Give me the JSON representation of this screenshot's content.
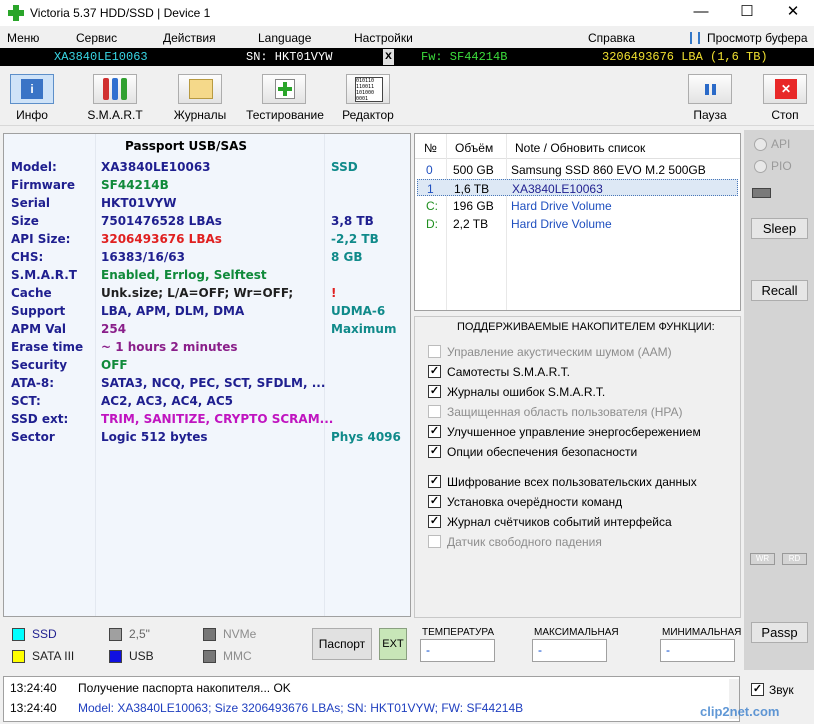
{
  "window": {
    "title": "Victoria 5.37 HDD/SSD | Device 1",
    "minimize": "—",
    "maximize": "☐",
    "close": "✕"
  },
  "menu": [
    "Меню",
    "Сервис",
    "Действия",
    "Language",
    "Настройки",
    "Справка",
    "Просмотр буфера"
  ],
  "infobar": {
    "model": "XA3840LE10063",
    "sn": "SN: HKT01VYW",
    "x": "x",
    "fw": "Fw: SF44214B",
    "lba": "3206493676 LBA (1,6 TB)",
    "colors": {
      "model": "#39d7e6",
      "sn": "#ffffff",
      "fw": "#3cdc3c",
      "lba": "#f0e030"
    }
  },
  "toolbar": {
    "info": "Инфо",
    "smart": "S.M.A.R.T",
    "logs": "Журналы",
    "test": "Тестирование",
    "editor": "Редактор",
    "pause": "Пауза",
    "stop": "Стоп",
    "editor_icon_text": "010110\n110011\n101000\n0001"
  },
  "passport": {
    "title": "Passport USB/SAS",
    "rows": [
      {
        "label": "Model:",
        "value": "XA3840LE10063",
        "extra": "SSD",
        "vcolor": "#1f1f8f",
        "ecolor": "#108a8a"
      },
      {
        "label": "Firmware",
        "value": "SF44214B",
        "extra": "",
        "vcolor": "#108a3a",
        "ecolor": ""
      },
      {
        "label": "Serial",
        "value": "HKT01VYW",
        "extra": "",
        "vcolor": "#1f1f8f",
        "ecolor": ""
      },
      {
        "label": "Size",
        "value": "7501476528 LBAs",
        "extra": "3,8 TB",
        "vcolor": "#1f1f8f",
        "ecolor": "#1f1f8f"
      },
      {
        "label": "API Size:",
        "value": "3206493676 LBAs",
        "extra": "-2,2 TB",
        "vcolor": "#e02020",
        "ecolor": "#108a8a"
      },
      {
        "label": "CHS:",
        "value": "16383/16/63",
        "extra": "8 GB",
        "vcolor": "#1f1f8f",
        "ecolor": "#108a8a"
      },
      {
        "label": "S.M.A.R.T",
        "value": "Enabled, Errlog, Selftest",
        "extra": "",
        "vcolor": "#108a3a",
        "ecolor": ""
      },
      {
        "label": "Cache",
        "value": "Unk.size; L/A=OFF; Wr=OFF;",
        "extra": "!",
        "vcolor": "#1f1f1f",
        "ecolor": "#e02020"
      },
      {
        "label": "Support",
        "value": "LBA, APM, DLM, DMA",
        "extra": "UDMA-6",
        "vcolor": "#1f1f8f",
        "ecolor": "#108a8a"
      },
      {
        "label": "APM Val",
        "value": "254",
        "extra": "Maximum",
        "vcolor": "#8a1f8a",
        "ecolor": "#108a8a"
      },
      {
        "label": "Erase time",
        "value": "~ 1 hours 2 minutes",
        "extra": "",
        "vcolor": "#8a1f8a",
        "ecolor": ""
      },
      {
        "label": "Security",
        "value": "OFF",
        "extra": "",
        "vcolor": "#108a3a",
        "ecolor": ""
      },
      {
        "label": "ATA-8:",
        "value": "SATA3, NCQ, PEC, SCT, SFDLM, ...",
        "extra": "",
        "vcolor": "#1f1f8f",
        "ecolor": ""
      },
      {
        "label": "SCT:",
        "value": "AC2, AC3, AC4, AC5",
        "extra": "",
        "vcolor": "#1f1f8f",
        "ecolor": ""
      },
      {
        "label": "SSD ext:",
        "value": "TRIM, SANITIZE, CRYPTO SCRAM...",
        "extra": "",
        "vcolor": "#c014c0",
        "ecolor": ""
      },
      {
        "label": "Sector",
        "value": "Logic 512 bytes",
        "extra": "Phys 4096",
        "vcolor": "#1f1f8f",
        "ecolor": "#108a8a"
      }
    ]
  },
  "drives": {
    "headers": [
      "№",
      "Объём",
      "Note / Обновить список"
    ],
    "rows": [
      {
        "n": "0",
        "size": "500 GB",
        "note": "Samsung SSD 860 EVO M.2 500GB",
        "ncolor": "#1f4fbf",
        "notecolor": "#000000"
      },
      {
        "n": "1",
        "size": "1,6 TB",
        "note": "XA3840LE10063",
        "ncolor": "#1f4fbf",
        "notecolor": "#1f1f8f"
      },
      {
        "n": "C:",
        "size": "196 GB",
        "note": "Hard Drive Volume",
        "ncolor": "#1f8f1f",
        "notecolor": "#1f4fbf"
      },
      {
        "n": "D:",
        "size": "2,2 TB",
        "note": "Hard Drive Volume",
        "ncolor": "#1f8f1f",
        "notecolor": "#1f4fbf"
      }
    ]
  },
  "features": {
    "title": "ПОДДЕРЖИВАЕМЫЕ НАКОПИТЕЛЕМ ФУНКЦИИ:",
    "items": [
      {
        "label": "Управление акустическим шумом (AAM)",
        "checked": false,
        "enabled": false
      },
      {
        "label": "Самотесты S.M.A.R.T.",
        "checked": true,
        "enabled": true
      },
      {
        "label": "Журналы ошибок S.M.A.R.T.",
        "checked": true,
        "enabled": true
      },
      {
        "label": "Защищенная область пользователя (HPA)",
        "checked": false,
        "enabled": false
      },
      {
        "label": "Улучшенное управление энергосбережением",
        "checked": true,
        "enabled": true
      },
      {
        "label": "Опции обеспечения безопасности",
        "checked": true,
        "enabled": true
      },
      {
        "label": "Шифрование всех пользовательских данных",
        "checked": true,
        "enabled": true
      },
      {
        "label": "Установка очерёдности команд",
        "checked": true,
        "enabled": true
      },
      {
        "label": "Журнал счётчиков событий интерфейса",
        "checked": true,
        "enabled": true
      },
      {
        "label": "Датчик свободного падения",
        "checked": false,
        "enabled": false
      }
    ]
  },
  "right": {
    "api": "API",
    "pio": "PIO",
    "sleep": "Sleep",
    "recall": "Recall",
    "wr": "WR",
    "rd": "RD",
    "passp": "Passp",
    "sound": "Звук"
  },
  "legend": [
    {
      "label": "SSD",
      "color": "#00ffff",
      "tcolor": "#1f1f8f"
    },
    {
      "label": "2,5\"",
      "color": "#a0a0a0",
      "tcolor": "#666666"
    },
    {
      "label": "NVMe",
      "color": "#777777",
      "tcolor": "#8d8d8d"
    },
    {
      "label": "SATA III",
      "color": "#ffff00",
      "tcolor": "#1f1f1f"
    },
    {
      "label": "USB",
      "color": "#1010e0",
      "tcolor": "#1f1f1f"
    },
    {
      "label": "MMC",
      "color": "#777777",
      "tcolor": "#8d8d8d"
    }
  ],
  "legend_buttons": {
    "passport": "Паспорт",
    "ext": "EXT"
  },
  "temps": {
    "cur_label": "ТЕМПЕРАТУРА",
    "max_label": "МАКСИМАЛЬНАЯ",
    "min_label": "МИНИМАЛЬНАЯ",
    "cur": "-",
    "max": "-",
    "min": "-"
  },
  "log": [
    {
      "time": "13:24:40",
      "msg": "Получение паспорта накопителя... OK",
      "color": "#000000"
    },
    {
      "time": "13:24:40",
      "msg": "Model: XA3840LE10063; Size 3206493676 LBAs; SN: HKT01VYW; FW: SF44214B",
      "color": "#1f3fbf"
    }
  ],
  "watermark": "clip2net.com"
}
